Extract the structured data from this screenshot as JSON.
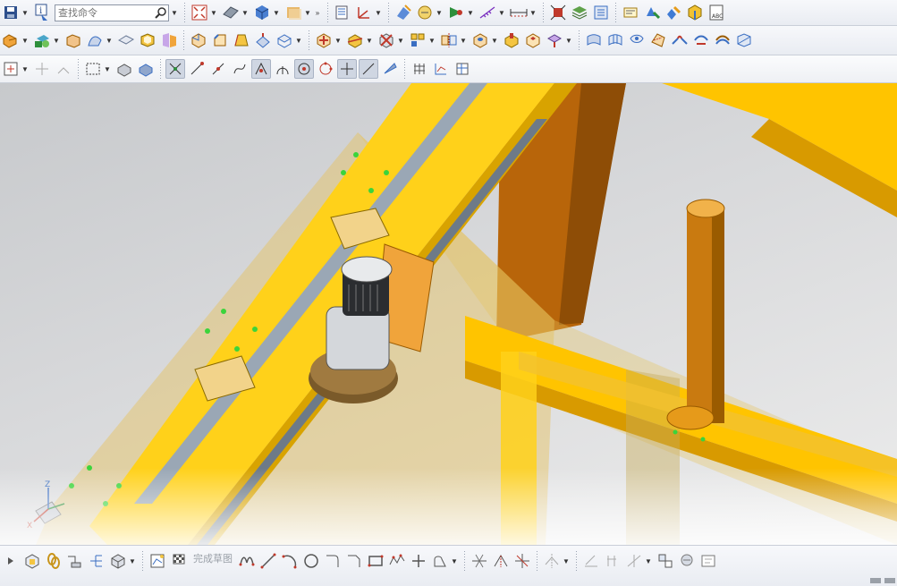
{
  "toolbar_top": {
    "search_placeholder": "查找命令",
    "overflow_glyph": "»"
  },
  "toolbar_bottom": {
    "finish_sketch_label": "完成草图"
  },
  "viewport": {
    "triad_axes": [
      "Z",
      "X"
    ],
    "background_top": "#c7c9cc",
    "background_bottom": "#ececec",
    "frame_color": "#ffd11a",
    "frame_shadow": "#d8a300",
    "post_color": "#b8650a",
    "rail_color": "#9aa7b5"
  }
}
